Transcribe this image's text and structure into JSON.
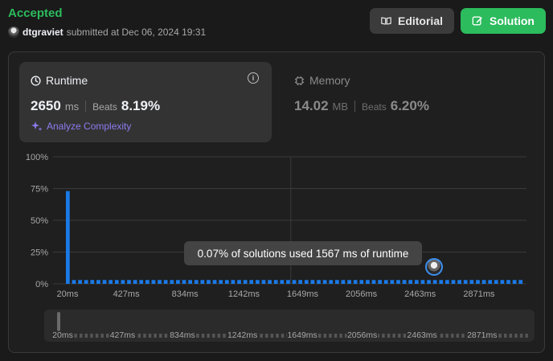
{
  "header": {
    "status": "Accepted",
    "username": "dtgraviet",
    "submitted_text": "submitted at Dec 06, 2024 19:31",
    "editorial_label": "Editorial",
    "solution_label": "Solution"
  },
  "runtime": {
    "title": "Runtime",
    "value": "2650",
    "unit": "ms",
    "beats_label": "Beats",
    "beats_pct": "8.19%",
    "analyze_label": "Analyze Complexity"
  },
  "memory": {
    "title": "Memory",
    "value": "14.02",
    "unit": "MB",
    "beats_label": "Beats",
    "beats_pct": "6.20%"
  },
  "tooltip": "0.07% of solutions used 1567 ms of runtime",
  "colors": {
    "accent_green": "#2cbb5d",
    "bar_blue": "#1a7ae8",
    "purple": "#8c7cf0"
  },
  "chart_data": {
    "type": "bar",
    "y_ticks": [
      "100%",
      "75%",
      "50%",
      "25%",
      "0%"
    ],
    "x_ticks": [
      "20ms",
      "427ms",
      "834ms",
      "1242ms",
      "1649ms",
      "2056ms",
      "2463ms",
      "2871ms"
    ],
    "ylim": [
      0,
      100
    ],
    "xlim": [
      20,
      3200
    ],
    "bars": {
      "count": 75,
      "values": [
        73,
        3,
        3,
        3,
        3,
        3,
        3,
        3,
        3,
        3,
        3,
        3,
        3,
        3,
        3,
        3,
        3,
        3,
        3,
        3,
        3,
        3,
        3,
        3,
        3,
        3,
        3,
        3,
        3,
        3,
        3,
        3,
        3,
        3,
        3,
        3,
        3,
        3,
        3,
        3,
        3,
        3,
        3,
        3,
        3,
        3,
        3,
        3,
        3,
        3,
        3,
        3,
        3,
        3,
        3,
        3,
        3,
        3,
        3,
        3,
        3,
        3,
        3,
        3,
        3,
        3,
        3,
        3,
        3,
        3,
        3,
        3,
        3,
        3,
        3
      ]
    },
    "highlight_x": 1567,
    "grid": true,
    "user_marker_x": 2650
  }
}
